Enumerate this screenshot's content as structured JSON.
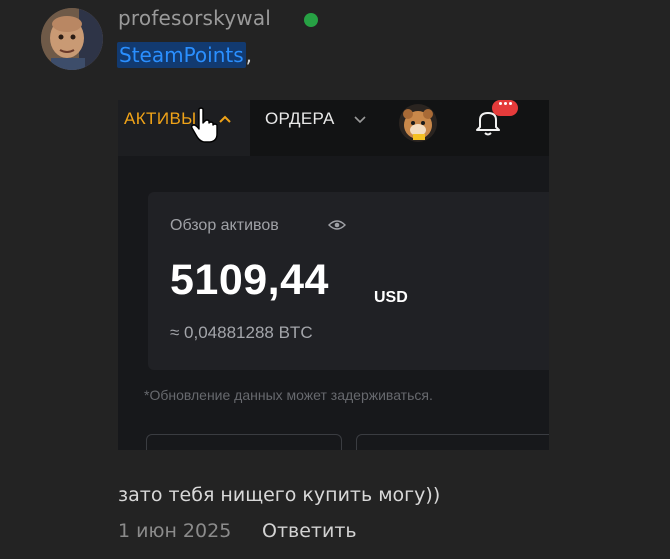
{
  "comment": {
    "username": "profesorskywal",
    "mention": "SteamPoints",
    "mention_suffix": ",",
    "text": "зато тебя нищего купить могу))",
    "date": "1 июн 2025",
    "reply_label": "Ответить",
    "status": "online"
  },
  "screenshot": {
    "nav": {
      "assets_label": "АКТИВЫ",
      "orders_label": "ОРДЕРА",
      "notification_badge": "···"
    },
    "card": {
      "title": "Обзор активов",
      "balance": "5109,44",
      "currency": "USD",
      "btc_value": "≈ 0,04881288 BTC"
    },
    "note": "*Обновление данных может задерживаться."
  },
  "colors": {
    "background": "#232323",
    "mention": "#2a8fff",
    "mention_bg": "#123a70",
    "online": "#27a144",
    "assets_accent": "#f0a318",
    "badge": "#e53b3b"
  }
}
